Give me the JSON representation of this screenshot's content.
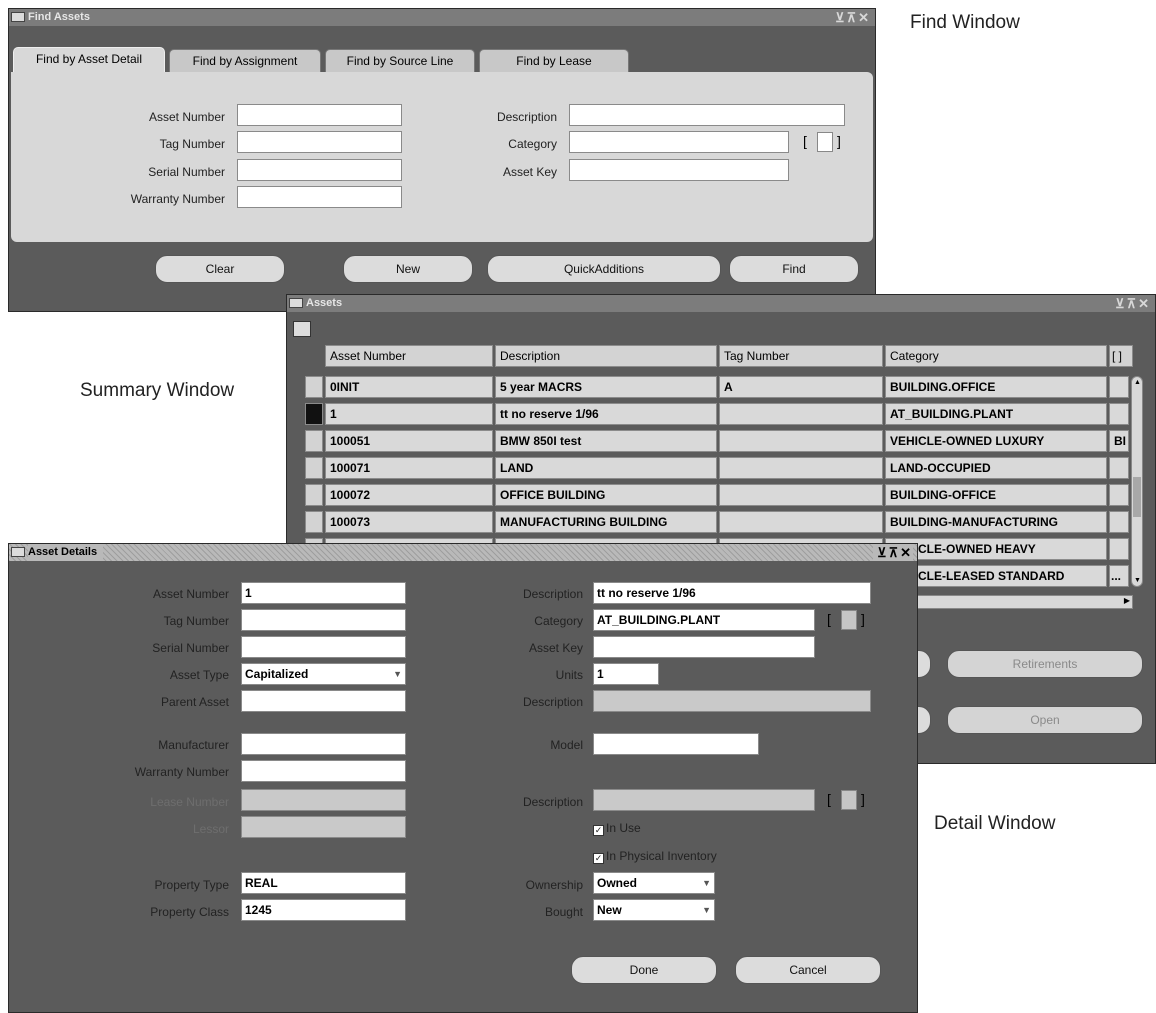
{
  "callouts": {
    "find": "Find Window",
    "summary": "Summary Window",
    "detail": "Detail Window"
  },
  "find_window": {
    "title": "Find Assets",
    "tabs": [
      "Find by Asset Detail",
      "Find by Assignment",
      "Find by Source Line",
      "Find by Lease"
    ],
    "left_labels": [
      "Asset Number",
      "Tag Number",
      "Serial Number",
      "Warranty Number"
    ],
    "right_labels": [
      "Description",
      "Category",
      "Asset Key"
    ],
    "buttons": [
      "Clear",
      "New",
      "QuickAdditions",
      "Find"
    ]
  },
  "summary_window": {
    "title": "Assets",
    "columns": [
      "Asset Number",
      "Description",
      "Tag Number",
      "Category",
      "[ ]"
    ],
    "rows": [
      {
        "asset": "0INIT",
        "desc": "5 year MACRS",
        "tag": "A",
        "cat": "BUILDING.OFFICE",
        "flex": ""
      },
      {
        "asset": "1",
        "desc": "tt no reserve 1/96",
        "tag": "",
        "cat": "AT_BUILDING.PLANT",
        "flex": ""
      },
      {
        "asset": "100051",
        "desc": "BMW 850I test",
        "tag": "",
        "cat": "VEHICLE-OWNED LUXURY",
        "flex": "BI"
      },
      {
        "asset": "100071",
        "desc": "LAND",
        "tag": "",
        "cat": "LAND-OCCUPIED",
        "flex": ""
      },
      {
        "asset": "100072",
        "desc": "OFFICE BUILDING",
        "tag": "",
        "cat": "BUILDING-OFFICE",
        "flex": ""
      },
      {
        "asset": "100073",
        "desc": "MANUFACTURING BUILDING",
        "tag": "",
        "cat": "BUILDING-MANUFACTURING",
        "flex": ""
      },
      {
        "asset": "",
        "desc": "",
        "tag": "",
        "cat": "VEHICLE-OWNED HEAVY",
        "flex": ""
      },
      {
        "asset": "",
        "desc": "",
        "tag": "",
        "cat": "VEHICLE-LEASED STANDARD",
        "flex": "..."
      }
    ],
    "buttons": [
      "Retirements",
      "Open"
    ]
  },
  "detail_window": {
    "title": "Asset Details",
    "left": {
      "asset_number_label": "Asset Number",
      "asset_number": "1",
      "tag_number_label": "Tag Number",
      "tag_number": "",
      "serial_number_label": "Serial Number",
      "serial_number": "",
      "asset_type_label": "Asset Type",
      "asset_type": "Capitalized",
      "parent_asset_label": "Parent Asset",
      "parent_asset": "",
      "manufacturer_label": "Manufacturer",
      "manufacturer": "",
      "warranty_number_label": "Warranty Number",
      "warranty_number": "",
      "lease_number_label": "Lease Number",
      "lease_number": "",
      "lessor_label": "Lessor",
      "lessor": "",
      "property_type_label": "Property Type",
      "property_type": "REAL",
      "property_class_label": "Property Class",
      "property_class": "1245"
    },
    "right": {
      "description_label": "Description",
      "description": "tt no reserve 1/96",
      "category_label": "Category",
      "category": "AT_BUILDING.PLANT",
      "asset_key_label": "Asset Key",
      "asset_key": "",
      "units_label": "Units",
      "units": "1",
      "units_desc_label": "Description",
      "model_label": "Model",
      "model": "",
      "warranty_desc_label": "Description",
      "in_use_label": "In Use",
      "in_use_checked": true,
      "in_physical_inventory_label": "In Physical Inventory",
      "in_physical_inventory_checked": true,
      "ownership_label": "Ownership",
      "ownership": "Owned",
      "bought_label": "Bought",
      "bought": "New"
    },
    "buttons": [
      "Done",
      "Cancel"
    ]
  }
}
